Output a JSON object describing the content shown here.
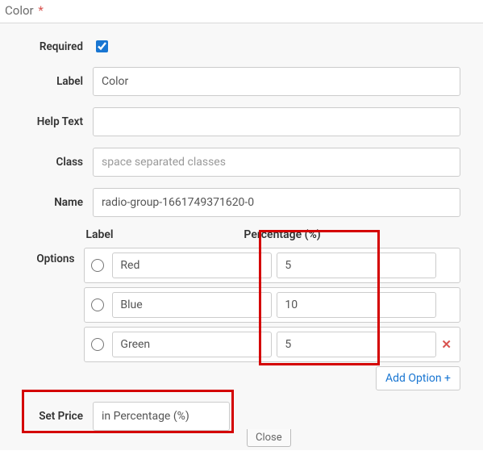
{
  "header": {
    "title": "Color",
    "required_mark": "*"
  },
  "form": {
    "required_label": "Required",
    "required_checked": true,
    "label_label": "Label",
    "label_value": "Color",
    "help_label": "Help Text",
    "help_value": "",
    "class_label": "Class",
    "class_placeholder": "space separated classes",
    "name_label": "Name",
    "name_value": "radio-group-1661749371620-0",
    "options_label": "Options",
    "options_head_label": "Label",
    "options_head_pct": "Percentage (%)",
    "options": [
      {
        "label": "Red",
        "pct": "5",
        "removable": false
      },
      {
        "label": "Blue",
        "pct": "10",
        "removable": false
      },
      {
        "label": "Green",
        "pct": "5",
        "removable": true
      }
    ],
    "remove_icon": "✕",
    "add_option_label": "Add Option +",
    "set_price_label": "Set Price",
    "set_price_value": "in Percentage (%)",
    "close_label": "Close"
  }
}
